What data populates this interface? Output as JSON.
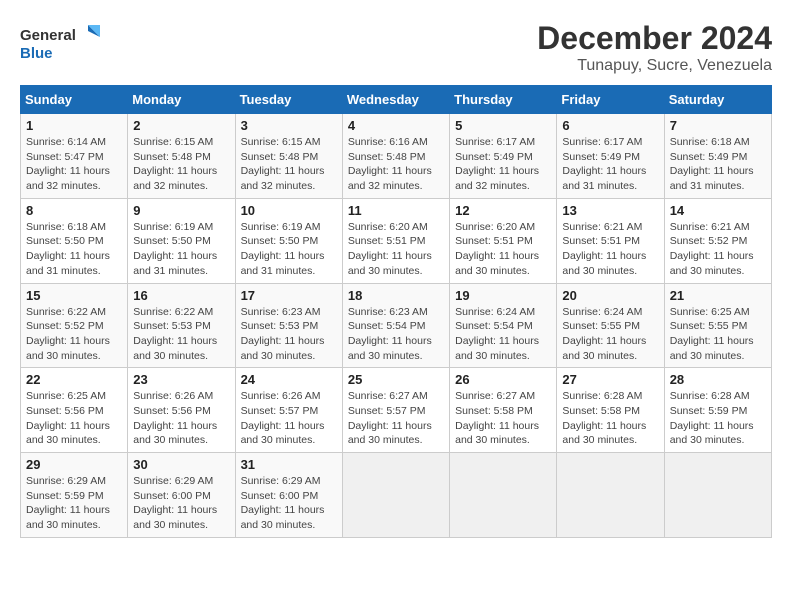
{
  "logo": {
    "line1": "General",
    "line2": "Blue"
  },
  "title": "December 2024",
  "subtitle": "Tunapuy, Sucre, Venezuela",
  "days_header": [
    "Sunday",
    "Monday",
    "Tuesday",
    "Wednesday",
    "Thursday",
    "Friday",
    "Saturday"
  ],
  "weeks": [
    [
      {
        "day": "1",
        "info": "Sunrise: 6:14 AM\nSunset: 5:47 PM\nDaylight: 11 hours\nand 32 minutes."
      },
      {
        "day": "2",
        "info": "Sunrise: 6:15 AM\nSunset: 5:48 PM\nDaylight: 11 hours\nand 32 minutes."
      },
      {
        "day": "3",
        "info": "Sunrise: 6:15 AM\nSunset: 5:48 PM\nDaylight: 11 hours\nand 32 minutes."
      },
      {
        "day": "4",
        "info": "Sunrise: 6:16 AM\nSunset: 5:48 PM\nDaylight: 11 hours\nand 32 minutes."
      },
      {
        "day": "5",
        "info": "Sunrise: 6:17 AM\nSunset: 5:49 PM\nDaylight: 11 hours\nand 32 minutes."
      },
      {
        "day": "6",
        "info": "Sunrise: 6:17 AM\nSunset: 5:49 PM\nDaylight: 11 hours\nand 31 minutes."
      },
      {
        "day": "7",
        "info": "Sunrise: 6:18 AM\nSunset: 5:49 PM\nDaylight: 11 hours\nand 31 minutes."
      }
    ],
    [
      {
        "day": "8",
        "info": "Sunrise: 6:18 AM\nSunset: 5:50 PM\nDaylight: 11 hours\nand 31 minutes."
      },
      {
        "day": "9",
        "info": "Sunrise: 6:19 AM\nSunset: 5:50 PM\nDaylight: 11 hours\nand 31 minutes."
      },
      {
        "day": "10",
        "info": "Sunrise: 6:19 AM\nSunset: 5:50 PM\nDaylight: 11 hours\nand 31 minutes."
      },
      {
        "day": "11",
        "info": "Sunrise: 6:20 AM\nSunset: 5:51 PM\nDaylight: 11 hours\nand 30 minutes."
      },
      {
        "day": "12",
        "info": "Sunrise: 6:20 AM\nSunset: 5:51 PM\nDaylight: 11 hours\nand 30 minutes."
      },
      {
        "day": "13",
        "info": "Sunrise: 6:21 AM\nSunset: 5:51 PM\nDaylight: 11 hours\nand 30 minutes."
      },
      {
        "day": "14",
        "info": "Sunrise: 6:21 AM\nSunset: 5:52 PM\nDaylight: 11 hours\nand 30 minutes."
      }
    ],
    [
      {
        "day": "15",
        "info": "Sunrise: 6:22 AM\nSunset: 5:52 PM\nDaylight: 11 hours\nand 30 minutes."
      },
      {
        "day": "16",
        "info": "Sunrise: 6:22 AM\nSunset: 5:53 PM\nDaylight: 11 hours\nand 30 minutes."
      },
      {
        "day": "17",
        "info": "Sunrise: 6:23 AM\nSunset: 5:53 PM\nDaylight: 11 hours\nand 30 minutes."
      },
      {
        "day": "18",
        "info": "Sunrise: 6:23 AM\nSunset: 5:54 PM\nDaylight: 11 hours\nand 30 minutes."
      },
      {
        "day": "19",
        "info": "Sunrise: 6:24 AM\nSunset: 5:54 PM\nDaylight: 11 hours\nand 30 minutes."
      },
      {
        "day": "20",
        "info": "Sunrise: 6:24 AM\nSunset: 5:55 PM\nDaylight: 11 hours\nand 30 minutes."
      },
      {
        "day": "21",
        "info": "Sunrise: 6:25 AM\nSunset: 5:55 PM\nDaylight: 11 hours\nand 30 minutes."
      }
    ],
    [
      {
        "day": "22",
        "info": "Sunrise: 6:25 AM\nSunset: 5:56 PM\nDaylight: 11 hours\nand 30 minutes."
      },
      {
        "day": "23",
        "info": "Sunrise: 6:26 AM\nSunset: 5:56 PM\nDaylight: 11 hours\nand 30 minutes."
      },
      {
        "day": "24",
        "info": "Sunrise: 6:26 AM\nSunset: 5:57 PM\nDaylight: 11 hours\nand 30 minutes."
      },
      {
        "day": "25",
        "info": "Sunrise: 6:27 AM\nSunset: 5:57 PM\nDaylight: 11 hours\nand 30 minutes."
      },
      {
        "day": "26",
        "info": "Sunrise: 6:27 AM\nSunset: 5:58 PM\nDaylight: 11 hours\nand 30 minutes."
      },
      {
        "day": "27",
        "info": "Sunrise: 6:28 AM\nSunset: 5:58 PM\nDaylight: 11 hours\nand 30 minutes."
      },
      {
        "day": "28",
        "info": "Sunrise: 6:28 AM\nSunset: 5:59 PM\nDaylight: 11 hours\nand 30 minutes."
      }
    ],
    [
      {
        "day": "29",
        "info": "Sunrise: 6:29 AM\nSunset: 5:59 PM\nDaylight: 11 hours\nand 30 minutes."
      },
      {
        "day": "30",
        "info": "Sunrise: 6:29 AM\nSunset: 6:00 PM\nDaylight: 11 hours\nand 30 minutes."
      },
      {
        "day": "31",
        "info": "Sunrise: 6:29 AM\nSunset: 6:00 PM\nDaylight: 11 hours\nand 30 minutes."
      },
      {
        "day": "",
        "info": ""
      },
      {
        "day": "",
        "info": ""
      },
      {
        "day": "",
        "info": ""
      },
      {
        "day": "",
        "info": ""
      }
    ]
  ]
}
